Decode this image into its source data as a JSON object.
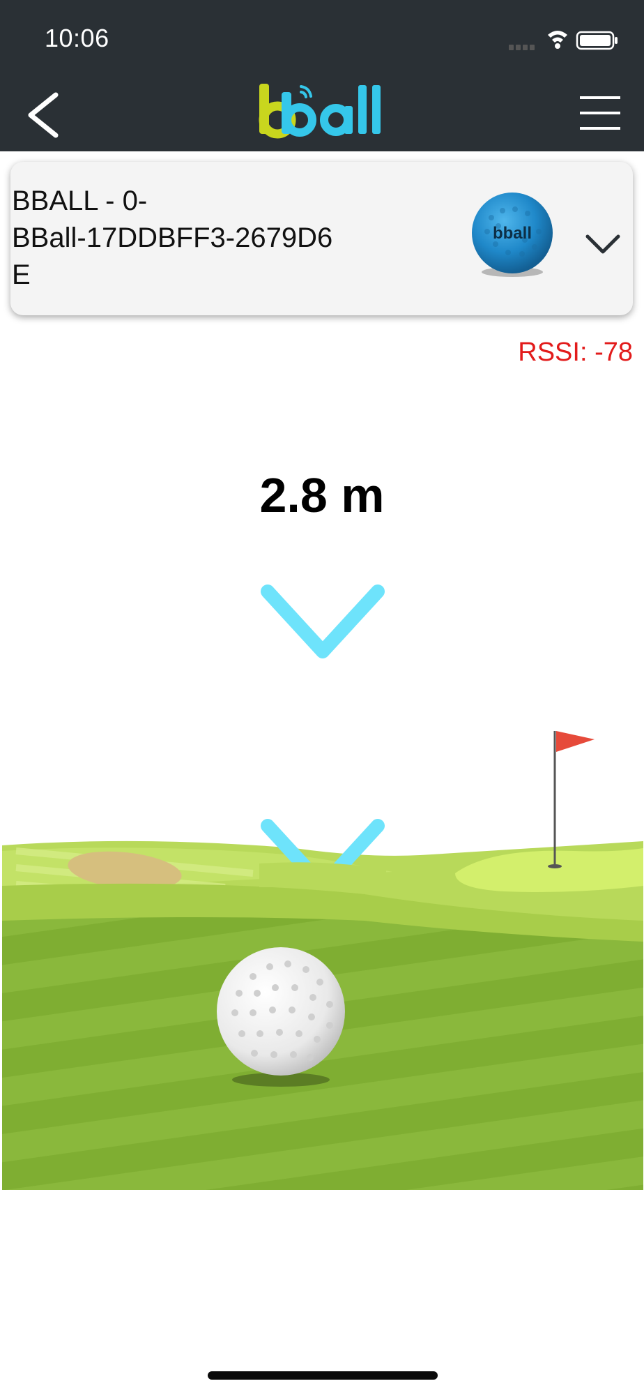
{
  "status_bar": {
    "time": "10:06"
  },
  "header": {
    "logo_text": "bball",
    "back_icon": "chevron-left-icon",
    "menu_icon": "hamburger-menu-icon"
  },
  "device": {
    "name": "BBALL - 0-\nBBall-17DDBFF3-2679D6\nE",
    "ball_image": "blue-golf-ball",
    "dropdown_icon": "chevron-down-icon"
  },
  "rssi": "RSSI: -78",
  "distance": "2.8 m",
  "colors": {
    "header_bg": "#2a3035",
    "accent_cyan": "#6ee3fb",
    "rssi_red": "#e21b1b",
    "logo_yellow": "#c9d61e",
    "logo_cyan": "#35c7ea",
    "ball_blue": "#1f88c9"
  }
}
